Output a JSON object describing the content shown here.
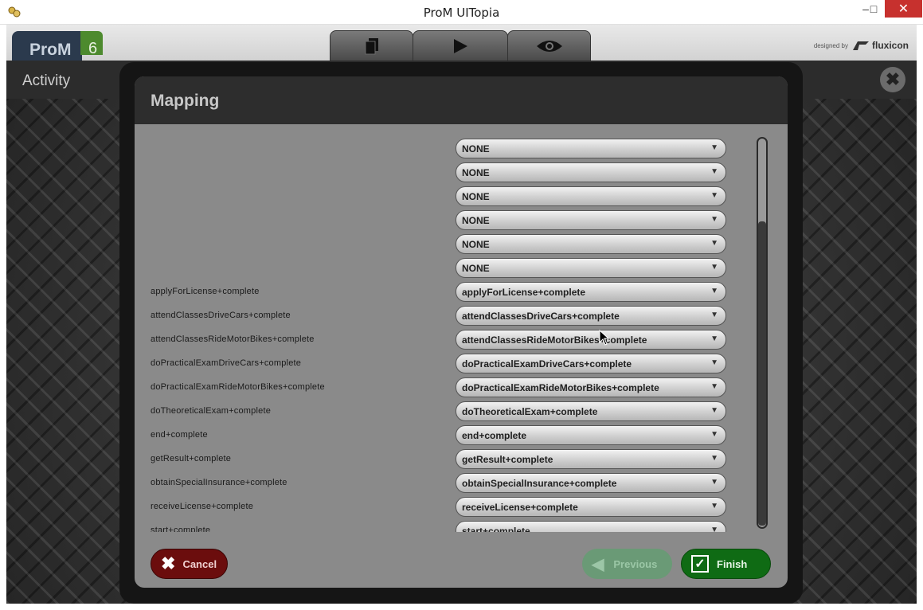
{
  "window": {
    "title": "ProM UITopia"
  },
  "header": {
    "logo_text": "ProM",
    "logo_version": "6",
    "designed_by": "designed by",
    "designer": "fluxicon"
  },
  "activity": {
    "label": "Activity"
  },
  "dialog": {
    "title": "Mapping",
    "rows": [
      {
        "label": "",
        "value": "NONE"
      },
      {
        "label": "",
        "value": "NONE"
      },
      {
        "label": "",
        "value": "NONE"
      },
      {
        "label": "",
        "value": "NONE"
      },
      {
        "label": "",
        "value": "NONE"
      },
      {
        "label": "",
        "value": "NONE"
      },
      {
        "label": "applyForLicense+complete",
        "value": "applyForLicense+complete"
      },
      {
        "label": "attendClassesDriveCars+complete",
        "value": "attendClassesDriveCars+complete"
      },
      {
        "label": "attendClassesRideMotorBikes+complete",
        "value": "attendClassesRideMotorBikes+complete"
      },
      {
        "label": "doPracticalExamDriveCars+complete",
        "value": "doPracticalExamDriveCars+complete"
      },
      {
        "label": "doPracticalExamRideMotorBikes+complete",
        "value": "doPracticalExamRideMotorBikes+complete"
      },
      {
        "label": "doTheoreticalExam+complete",
        "value": "doTheoreticalExam+complete"
      },
      {
        "label": "end+complete",
        "value": "end+complete"
      },
      {
        "label": "getResult+complete",
        "value": "getResult+complete"
      },
      {
        "label": "obtainSpecialInsurance+complete",
        "value": "obtainSpecialInsurance+complete"
      },
      {
        "label": "receiveLicense+complete",
        "value": "receiveLicense+complete"
      },
      {
        "label": "start+complete",
        "value": "start+complete"
      }
    ],
    "buttons": {
      "cancel": "Cancel",
      "previous": "Previous",
      "finish": "Finish"
    }
  }
}
